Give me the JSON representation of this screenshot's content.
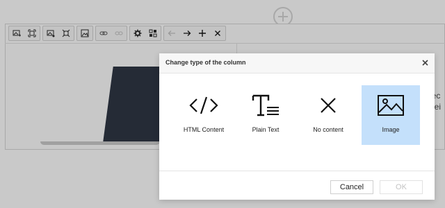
{
  "toolbar": {
    "groups": [
      [
        "image-add-icon",
        "image-resize-icon"
      ],
      [
        "image-edit-icon",
        "image-crop-icon"
      ],
      [
        "image-icon"
      ],
      [
        "link-icon",
        "unlink-icon"
      ],
      [
        "gear-icon",
        "grid-icon"
      ],
      [
        "arrow-left-icon",
        "arrow-right-icon",
        "plus-icon",
        "close-icon"
      ]
    ]
  },
  "background": {
    "side_text_1": "lec",
    "side_text_2": "hei"
  },
  "modal": {
    "title": "Change type of the column",
    "options": [
      {
        "label": "HTML Content",
        "icon": "code-icon",
        "selected": false
      },
      {
        "label": "Plain Text",
        "icon": "text-icon",
        "selected": false
      },
      {
        "label": "No content",
        "icon": "close-icon",
        "selected": false
      },
      {
        "label": "Image",
        "icon": "image-icon",
        "selected": true
      }
    ],
    "cancel_label": "Cancel",
    "ok_label": "OK"
  },
  "colors": {
    "overlay": "#c9c9c9",
    "selected_bg": "#c4e0fb",
    "modal_bg": "#ffffff"
  }
}
